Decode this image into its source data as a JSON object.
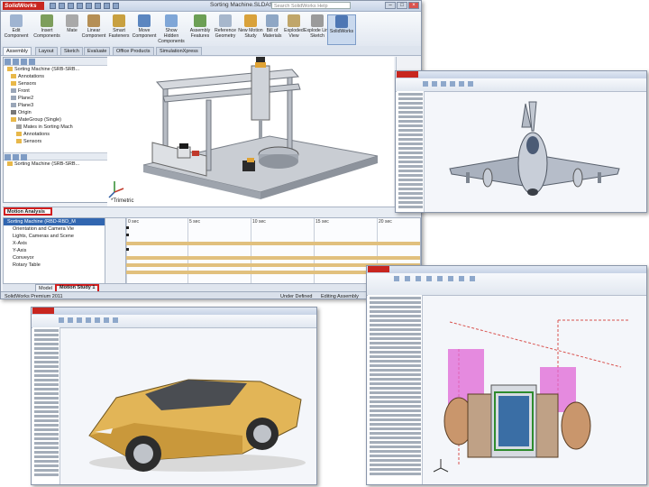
{
  "main_window": {
    "app_logo": "SolidWorks",
    "title": "Sorting Machine.SLDASM *",
    "search_placeholder": "Search SolidWorks Help",
    "ribbon_buttons": [
      {
        "label": "Edit Component"
      },
      {
        "label": "Insert Components"
      },
      {
        "label": "Mate"
      },
      {
        "label": "Linear Component"
      },
      {
        "label": "Smart Fasteners"
      },
      {
        "label": "Move Component"
      },
      {
        "label": "Show Hidden Components"
      },
      {
        "label": "Assembly Features"
      },
      {
        "label": "Reference Geometry"
      },
      {
        "label": "New Motion Study"
      },
      {
        "label": "Bill of Materials"
      },
      {
        "label": "Exploded View"
      },
      {
        "label": "Explode Line Sketch"
      },
      {
        "label": "SolidWorks"
      }
    ],
    "tabs": [
      "Assembly",
      "Layout",
      "Sketch",
      "Evaluate",
      "Office Products",
      "SimulationXpress"
    ],
    "tree_items": [
      "Sorting Machine (SRB-SRB...",
      "Annotations",
      "Sensors",
      "Front",
      "Plane2",
      "Plane3",
      "Origin",
      "MateGroup (Single)",
      "Mates in Sorting Mach",
      "Annotations",
      "Sensors"
    ],
    "tree2_item": "Sorting Machine (SRB-SRB...",
    "viewport_label": "*Trimetric",
    "motion": {
      "study_type": "Motion Analysis",
      "timeline_ticks": [
        "0 sec",
        "5 sec",
        "10 sec",
        "15 sec",
        "20 sec"
      ],
      "tree_items": [
        "Sorting Machine (RBD-RBD_M",
        "Orientation and Camera Vie",
        "Lights, Cameras and Scene",
        "X-Axis",
        "Y-Axis",
        "Conveyor",
        "Rotary Table"
      ]
    },
    "bottom_tabs": [
      "Model",
      "Motion Study 1"
    ],
    "status": {
      "product": "SolidWorks Premium 2011",
      "state": "Under Defined",
      "mode": "Editing Assembly"
    }
  }
}
